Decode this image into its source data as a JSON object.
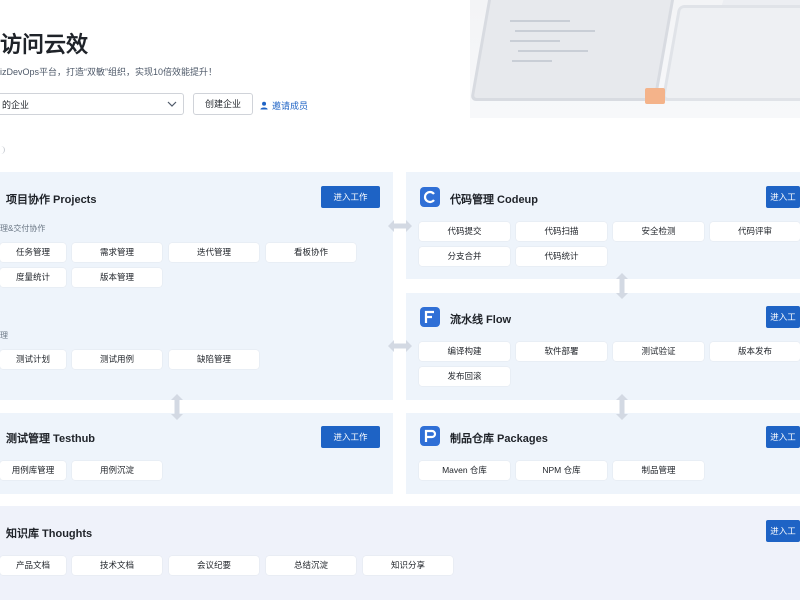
{
  "header": {
    "title": "访问云效",
    "subtitle": "izDevOps平台，打造“双敏”组织，实现10倍效能提升！",
    "org_select_value": "的企业",
    "create_org_label": "创建企业",
    "invite_label": "邀请成员"
  },
  "projects": {
    "title": "项目协作 Projects",
    "enter_label": "进入工作",
    "group1_label": "理&交付协作",
    "group1_items": [
      "任务管理",
      "需求管理",
      "迭代管理",
      "看板协作",
      "度量统计",
      "版本管理"
    ],
    "group2_label": "理",
    "group2_items": [
      "测试计划",
      "测试用例",
      "缺陷管理"
    ]
  },
  "codeup": {
    "title": "代码管理 Codeup",
    "enter_label": "进入工",
    "items": [
      "代码提交",
      "代码扫描",
      "安全检测",
      "代码评审",
      "分支合并",
      "代码统计"
    ]
  },
  "flow": {
    "title": "流水线 Flow",
    "enter_label": "进入工",
    "items": [
      "编译构建",
      "软件部署",
      "测试验证",
      "版本发布",
      "发布回滚"
    ]
  },
  "testhub": {
    "title": "测试管理 Testhub",
    "enter_label": "进入工作",
    "items": [
      "用例库管理",
      "用例沉淀"
    ]
  },
  "packages": {
    "title": "制品仓库 Packages",
    "enter_label": "进入工",
    "items": [
      "Maven 仓库",
      "NPM 仓库",
      "制品管理"
    ]
  },
  "thoughts": {
    "title": "知识库 Thoughts",
    "enter_label": "进入工",
    "items": [
      "产品文档",
      "技术文档",
      "会议纪要",
      "总结沉淀",
      "知识分享"
    ]
  },
  "colors": {
    "primary": "#1e63c5",
    "panel_bg": "#eef4fb"
  }
}
